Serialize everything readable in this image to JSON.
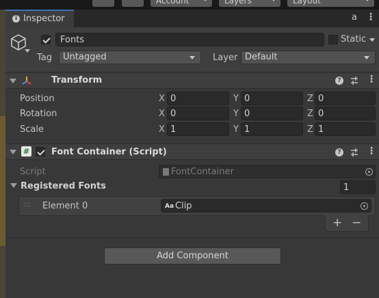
{
  "top_bar": {
    "account_label": "Account",
    "layers_label": "Layers",
    "layout_label": "Layout"
  },
  "tab": {
    "icon_glyph": "i",
    "label": "Inspector",
    "lock_glyph": "a",
    "menu_glyph": "⋮"
  },
  "header": {
    "object_name": "Fonts",
    "static_label": "Static",
    "tag_label": "Tag",
    "tag_value": "Untagged",
    "layer_label": "Layer",
    "layer_value": "Default"
  },
  "transform": {
    "title": "Transform",
    "help_glyph": "?",
    "rows": [
      {
        "label": "Position",
        "x": "0",
        "y": "0",
        "z": "0"
      },
      {
        "label": "Rotation",
        "x": "0",
        "y": "0",
        "z": "0"
      },
      {
        "label": "Scale",
        "x": "1",
        "y": "1",
        "z": "1"
      }
    ],
    "axis_x": "X",
    "axis_y": "Y",
    "axis_z": "Z"
  },
  "font_container": {
    "title": "Font Container (Script)",
    "script_glyph": "#",
    "help_glyph": "?",
    "script_label": "Script",
    "script_value": "FontContainer",
    "list_label": "Registered Fonts",
    "list_size": "1",
    "element_label": "Element 0",
    "element_icon_text": "Aa",
    "element_value": "Clip",
    "add_glyph": "+",
    "remove_glyph": "−"
  },
  "add_component_label": "Add Component",
  "colors": {
    "background": "#383838",
    "tab_accent": "#3a72b0",
    "field": "#2a2a2a",
    "button": "#585858"
  }
}
